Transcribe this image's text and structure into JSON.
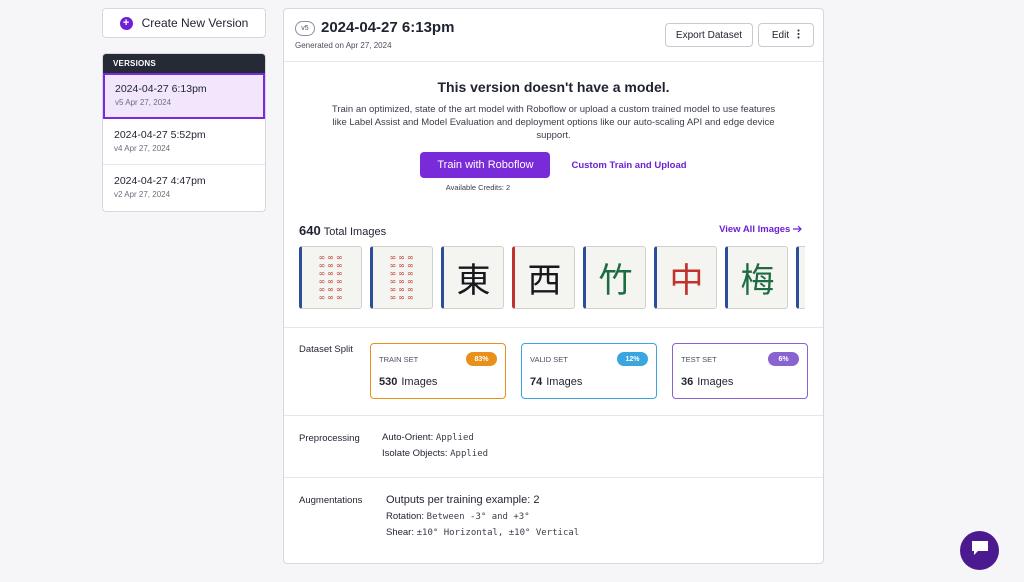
{
  "sidebar": {
    "create_label": "Create New Version",
    "versions_header": "VERSIONS",
    "versions": [
      {
        "title": "2024-04-27 6:13pm",
        "sub": "v5 Apr 27, 2024"
      },
      {
        "title": "2024-04-27 5:52pm",
        "sub": "v4 Apr 27, 2024"
      },
      {
        "title": "2024-04-27 4:47pm",
        "sub": "v2 Apr 27, 2024"
      }
    ]
  },
  "header": {
    "version_badge": "v5",
    "title": "2024-04-27 6:13pm",
    "subtitle": "Generated on Apr 27, 2024",
    "export_label": "Export Dataset",
    "edit_label": "Edit"
  },
  "model": {
    "title": "This version doesn't have a model.",
    "description": "Train an optimized, state of the art model with Roboflow or upload a custom trained model to use features like Label Assist and Model Evaluation and deployment options like our auto-scaling API and edge device support.",
    "train_label": "Train with Roboflow",
    "custom_label": "Custom Train and Upload",
    "credits": "Available Credits:  2"
  },
  "images": {
    "count": "640",
    "label": "Total Images",
    "view_all": "View All Images"
  },
  "split": {
    "label": "Dataset Split",
    "images_word": "Images",
    "cards": [
      {
        "name": "TRAIN SET",
        "pct": "83%",
        "count": "530",
        "color": "#e8901a"
      },
      {
        "name": "VALID SET",
        "pct": "12%",
        "count": "74",
        "color": "#3aa6e0"
      },
      {
        "name": "TEST SET",
        "pct": "6%",
        "count": "36",
        "color": "#8a63d2"
      }
    ]
  },
  "preprocessing": {
    "label": "Preprocessing",
    "items": [
      {
        "key": "Auto-Orient:",
        "value": "Applied"
      },
      {
        "key": "Isolate Objects:",
        "value": "Applied"
      }
    ]
  },
  "augmentations": {
    "label": "Augmentations",
    "outputs": "Outputs per training example: 2",
    "items": [
      {
        "key": "Rotation:",
        "value": "Between -3° and +3°"
      },
      {
        "key": "Shear:",
        "value": "±10° Horizontal, ±10° Vertical"
      }
    ]
  },
  "colors": {
    "accent": "#7a2bd9",
    "sidebar_header": "#252a36",
    "chat": "#4c1a8f"
  }
}
